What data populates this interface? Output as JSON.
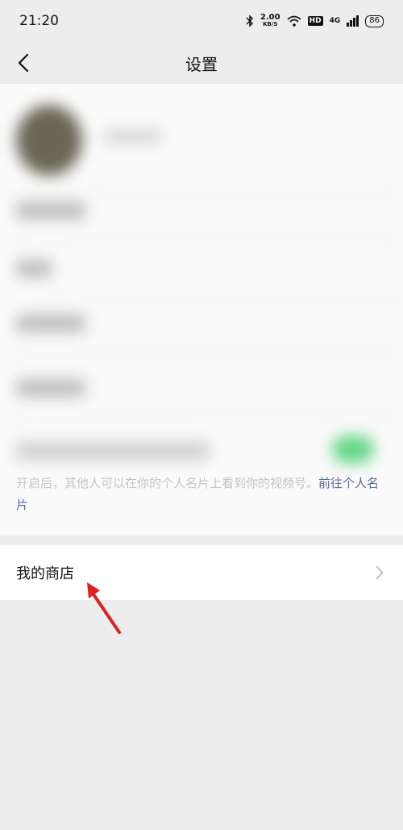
{
  "status_bar": {
    "time": "21:20",
    "speed_value": "2.00",
    "speed_unit": "KB/S",
    "hd": "HD",
    "network": "4G",
    "battery": "86"
  },
  "nav": {
    "title": "设置",
    "back_icon": "chevron-left-icon"
  },
  "hint": {
    "text": "开启后，其他人可以在你的个人名片上看到你的视频号。",
    "link": "前往个人名片"
  },
  "shop_row": {
    "label": "我的商店",
    "icon": "chevron-right-icon"
  },
  "colors": {
    "background": "#ededed",
    "toggle_on": "#63d686",
    "link": "#5b6b96",
    "annotation_arrow": "#e02020"
  }
}
